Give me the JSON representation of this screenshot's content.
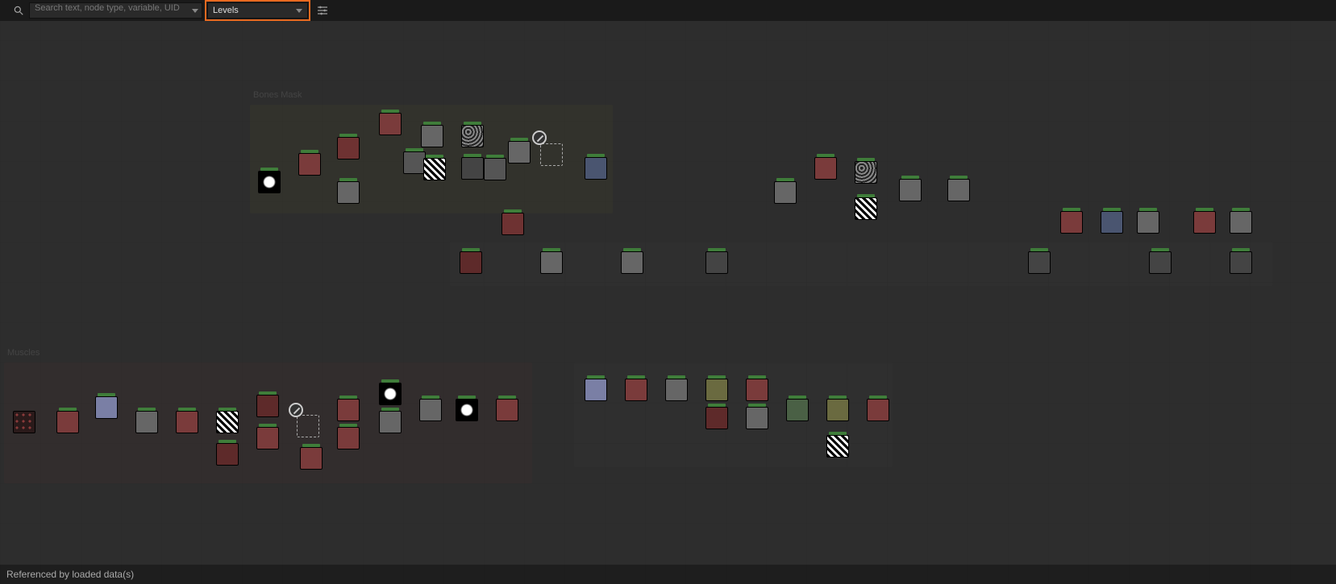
{
  "toolbar": {
    "search_placeholder": "Search text, node type, variable, UID",
    "filter_label": "Levels"
  },
  "frames": {
    "bones_label": "Bones Mask",
    "muscles_label": "Muscles"
  },
  "footer": {
    "status": "Referenced by loaded data(s)"
  }
}
